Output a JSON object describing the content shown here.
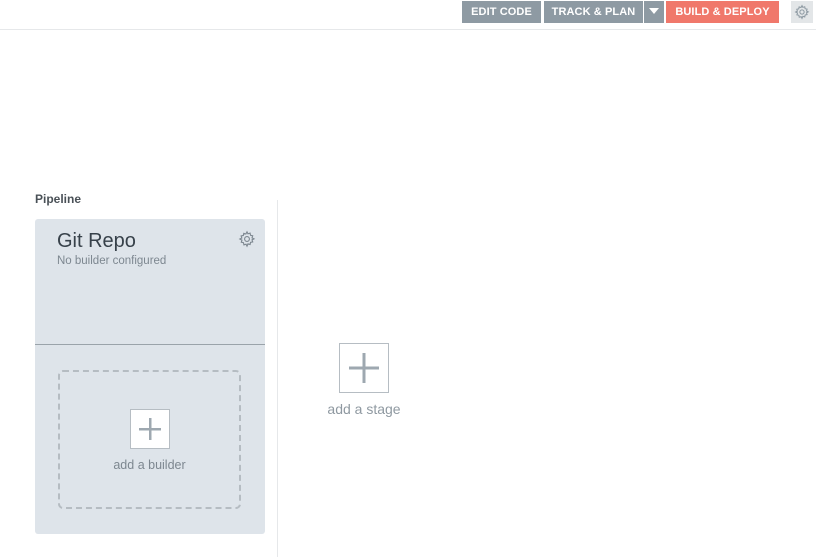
{
  "toolbar": {
    "edit_code": "EDIT CODE",
    "track_plan": "TRACK & PLAN",
    "build_deploy": "BUILD & DEPLOY"
  },
  "pipeline": {
    "label": "Pipeline",
    "stage": {
      "title": "Git Repo",
      "subtitle": "No builder configured",
      "add_builder": "add a builder"
    },
    "add_stage": "add a stage"
  },
  "colors": {
    "nav_gray": "#8e9aa3",
    "accent": "#f0786b",
    "stage_bg": "#dee4ea"
  },
  "icons": {
    "settings": "gear-icon",
    "stage_settings": "gear-icon",
    "dropdown": "caret-down-icon",
    "add": "plus-icon"
  }
}
